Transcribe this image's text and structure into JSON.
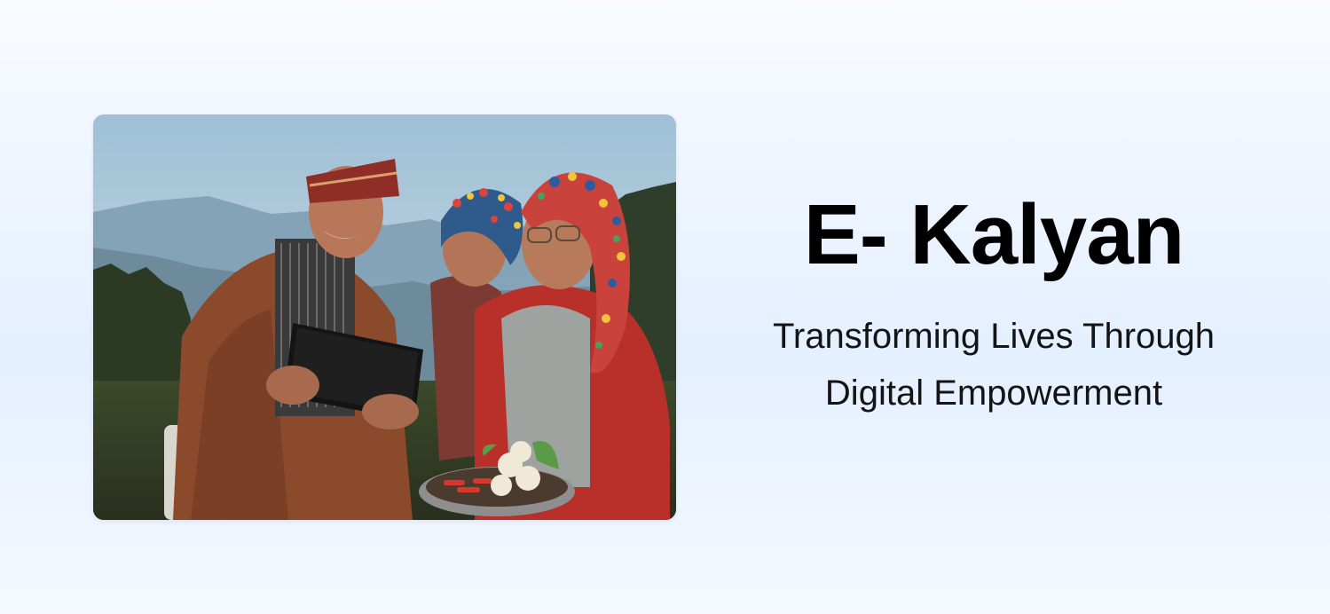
{
  "hero": {
    "title": "E- Kalyan",
    "subtitle": "Transforming Lives Through Digital Empowerment",
    "image_alt": "Elderly family members smiling while looking at a tablet outdoors"
  },
  "colors": {
    "background_top": "#f9fbff",
    "background_mid": "#e4efff",
    "title": "#000000",
    "subtitle": "#141414"
  }
}
